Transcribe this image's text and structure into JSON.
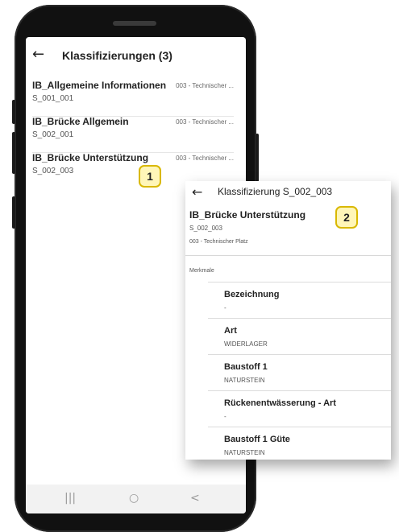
{
  "app": {
    "title": "Klassifizierungen (3)",
    "back_icon": "arrow-left-icon"
  },
  "list": {
    "items": [
      {
        "title": "IB_Allgemeine Informationen",
        "subtitle": "S_001_001",
        "meta": "003 - Technischer ..."
      },
      {
        "title": "IB_Brücke Allgemein",
        "subtitle": "S_002_001",
        "meta": "003 - Technischer ..."
      },
      {
        "title": "IB_Brücke Unterstützung",
        "subtitle": "S_002_003",
        "meta": "003 - Technischer ..."
      }
    ]
  },
  "navbar": {
    "recent": "|||",
    "home": "○",
    "back": "<"
  },
  "badges": {
    "one": "1",
    "two": "2"
  },
  "detail": {
    "title": "Klassifizierung S_002_003",
    "heading": "IB_Brücke Unterstützung",
    "subtitle": "S_002_003",
    "meta": "003 - Technischer Platz",
    "section_label": "Merkmale",
    "rows": [
      {
        "label": "Bezeichnung",
        "value": "-"
      },
      {
        "label": "Art",
        "value": "WIDERLAGER"
      },
      {
        "label": "Baustoff 1",
        "value": "NATURSTEIN"
      },
      {
        "label": "Rückenentwässerung - Art",
        "value": "-"
      },
      {
        "label": "Baustoff 1 Güte",
        "value": "NATURSTEIN"
      }
    ]
  },
  "colors": {
    "badge_fill": "#fff6b8",
    "badge_border": "#d9b800",
    "phone_body": "#111111"
  }
}
